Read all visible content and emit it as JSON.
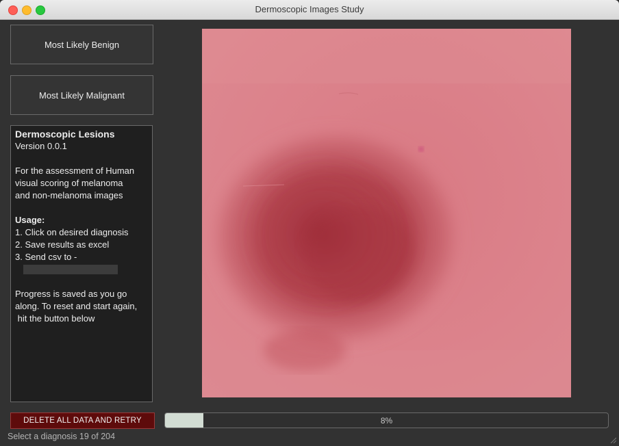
{
  "window": {
    "title": "Dermoscopic Images Study"
  },
  "buttons": {
    "benign": "Most Likely Benign",
    "malignant": "Most Likely Malignant",
    "delete": "DELETE ALL DATA AND RETRY"
  },
  "info": {
    "heading": "Dermoscopic Lesions",
    "version": "Version 0.0.1",
    "desc1": "For the assessment of Human",
    "desc2": "visual scoring of melanoma",
    "desc3": "and non-melanoma images",
    "usage_label": "Usage:",
    "step1": "1. Click on desired diagnosis",
    "step2": "2. Save results as excel",
    "step3": "3. Send csv to -",
    "note1": "Progress is saved as you go",
    "note2": "along. To reset and start again,",
    "note3": " hit the button below"
  },
  "progress": {
    "text": "8%",
    "fraction": 0.086
  },
  "status": "Select a diagnosis 19 of 204",
  "colors": {
    "delete_bg": "#5e0b0b",
    "progress_fill": "#d2dcd3",
    "skin": "#dc8088",
    "lesion": "#a8323e"
  }
}
